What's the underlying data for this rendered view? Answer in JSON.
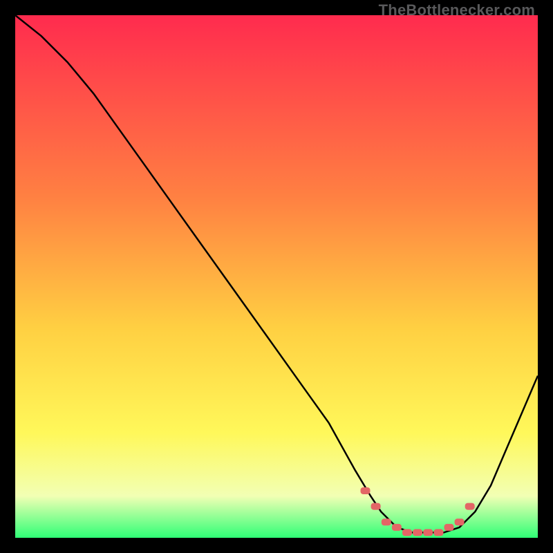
{
  "watermark_text": "TheBottlenecker.com",
  "colors": {
    "background": "#000000",
    "curve": "#000000",
    "marker": "#e36666",
    "gradient_top": "#ff2b4e",
    "gradient_mid1": "#ff8142",
    "gradient_mid2": "#ffd042",
    "gradient_mid3": "#fff85a",
    "gradient_mid4": "#f2ffb4",
    "gradient_bottom": "#2fff76"
  },
  "chart_data": {
    "type": "line",
    "title": "",
    "xlabel": "",
    "ylabel": "",
    "xlim": [
      0,
      100
    ],
    "ylim": [
      0,
      100
    ],
    "series": [
      {
        "name": "bottleneck-curve",
        "x": [
          0,
          5,
          10,
          15,
          20,
          25,
          30,
          35,
          40,
          45,
          50,
          55,
          60,
          65,
          68,
          70,
          73,
          76,
          79,
          82,
          85,
          88,
          91,
          94,
          97,
          100
        ],
        "y": [
          100,
          96,
          91,
          85,
          78,
          71,
          64,
          57,
          50,
          43,
          36,
          29,
          22,
          13,
          8,
          5,
          2,
          1,
          1,
          1,
          2,
          5,
          10,
          17,
          24,
          31
        ]
      }
    ],
    "markers": {
      "name": "highlight-band",
      "x": [
        67,
        69,
        71,
        73,
        75,
        77,
        79,
        81,
        83,
        85,
        87
      ],
      "y": [
        9,
        6,
        3,
        2,
        1,
        1,
        1,
        1,
        2,
        3,
        6
      ]
    }
  }
}
